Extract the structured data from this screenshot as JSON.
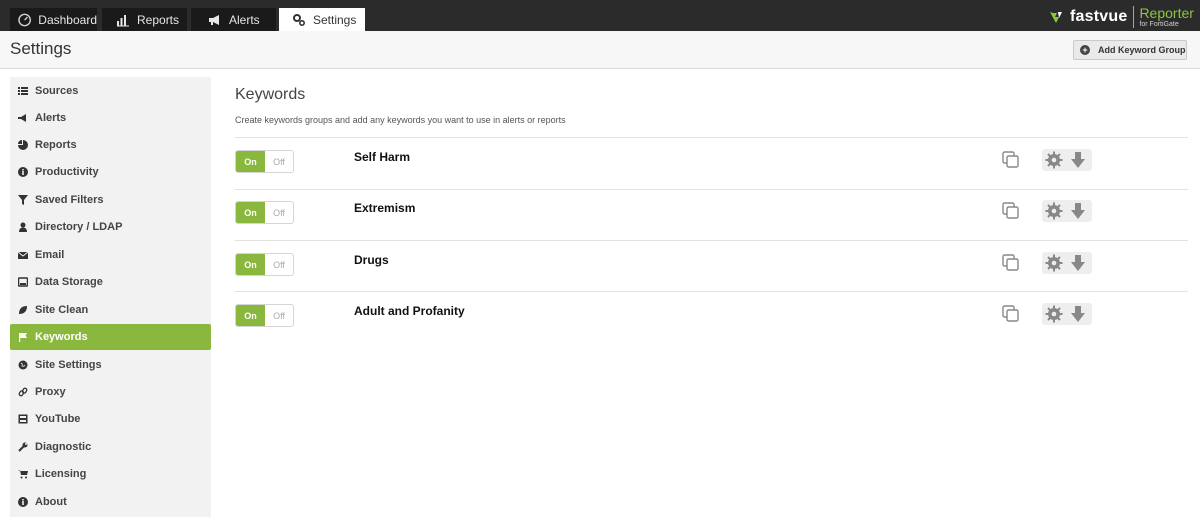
{
  "nav": {
    "tabs": [
      {
        "label": "Dashboard",
        "icon": "dashboard-icon"
      },
      {
        "label": "Reports",
        "icon": "bar-chart-icon"
      },
      {
        "label": "Alerts",
        "icon": "megaphone-icon"
      },
      {
        "label": "Settings",
        "icon": "gears-icon",
        "active": true
      }
    ]
  },
  "brand": {
    "name": "fastvue",
    "product": "Reporter",
    "subtitle": "for FortiGate",
    "accent": "#8dc63f"
  },
  "header": {
    "title": "Settings",
    "add_button_label": "Add Keyword Group"
  },
  "sidebar": {
    "items": [
      {
        "label": "Sources",
        "icon": "list-icon"
      },
      {
        "label": "Alerts",
        "icon": "megaphone-icon"
      },
      {
        "label": "Reports",
        "icon": "pie-chart-icon"
      },
      {
        "label": "Productivity",
        "icon": "info-circle-icon"
      },
      {
        "label": "Saved Filters",
        "icon": "filter-icon"
      },
      {
        "label": "Directory / LDAP",
        "icon": "user-icon"
      },
      {
        "label": "Email",
        "icon": "envelope-icon"
      },
      {
        "label": "Data Storage",
        "icon": "drive-icon"
      },
      {
        "label": "Site Clean",
        "icon": "leaf-icon"
      },
      {
        "label": "Keywords",
        "icon": "flag-icon",
        "active": true
      },
      {
        "label": "Site Settings",
        "icon": "globe-icon"
      },
      {
        "label": "Proxy",
        "icon": "link-icon"
      },
      {
        "label": "YouTube",
        "icon": "video-icon"
      },
      {
        "label": "Diagnostic",
        "icon": "wrench-icon"
      },
      {
        "label": "Licensing",
        "icon": "cart-icon"
      },
      {
        "label": "About",
        "icon": "info-icon"
      }
    ]
  },
  "main": {
    "title": "Keywords",
    "description": "Create keywords groups and add any keywords you want to use in alerts or reports",
    "toggle_on": "On",
    "toggle_off": "Off",
    "groups": [
      {
        "name": "Self Harm",
        "enabled": true
      },
      {
        "name": "Extremism",
        "enabled": true
      },
      {
        "name": "Drugs",
        "enabled": true
      },
      {
        "name": "Adult and Profanity",
        "enabled": true
      }
    ]
  },
  "colors": {
    "accent_green": "#8ab83f",
    "topbar": "#2b2b2b"
  }
}
